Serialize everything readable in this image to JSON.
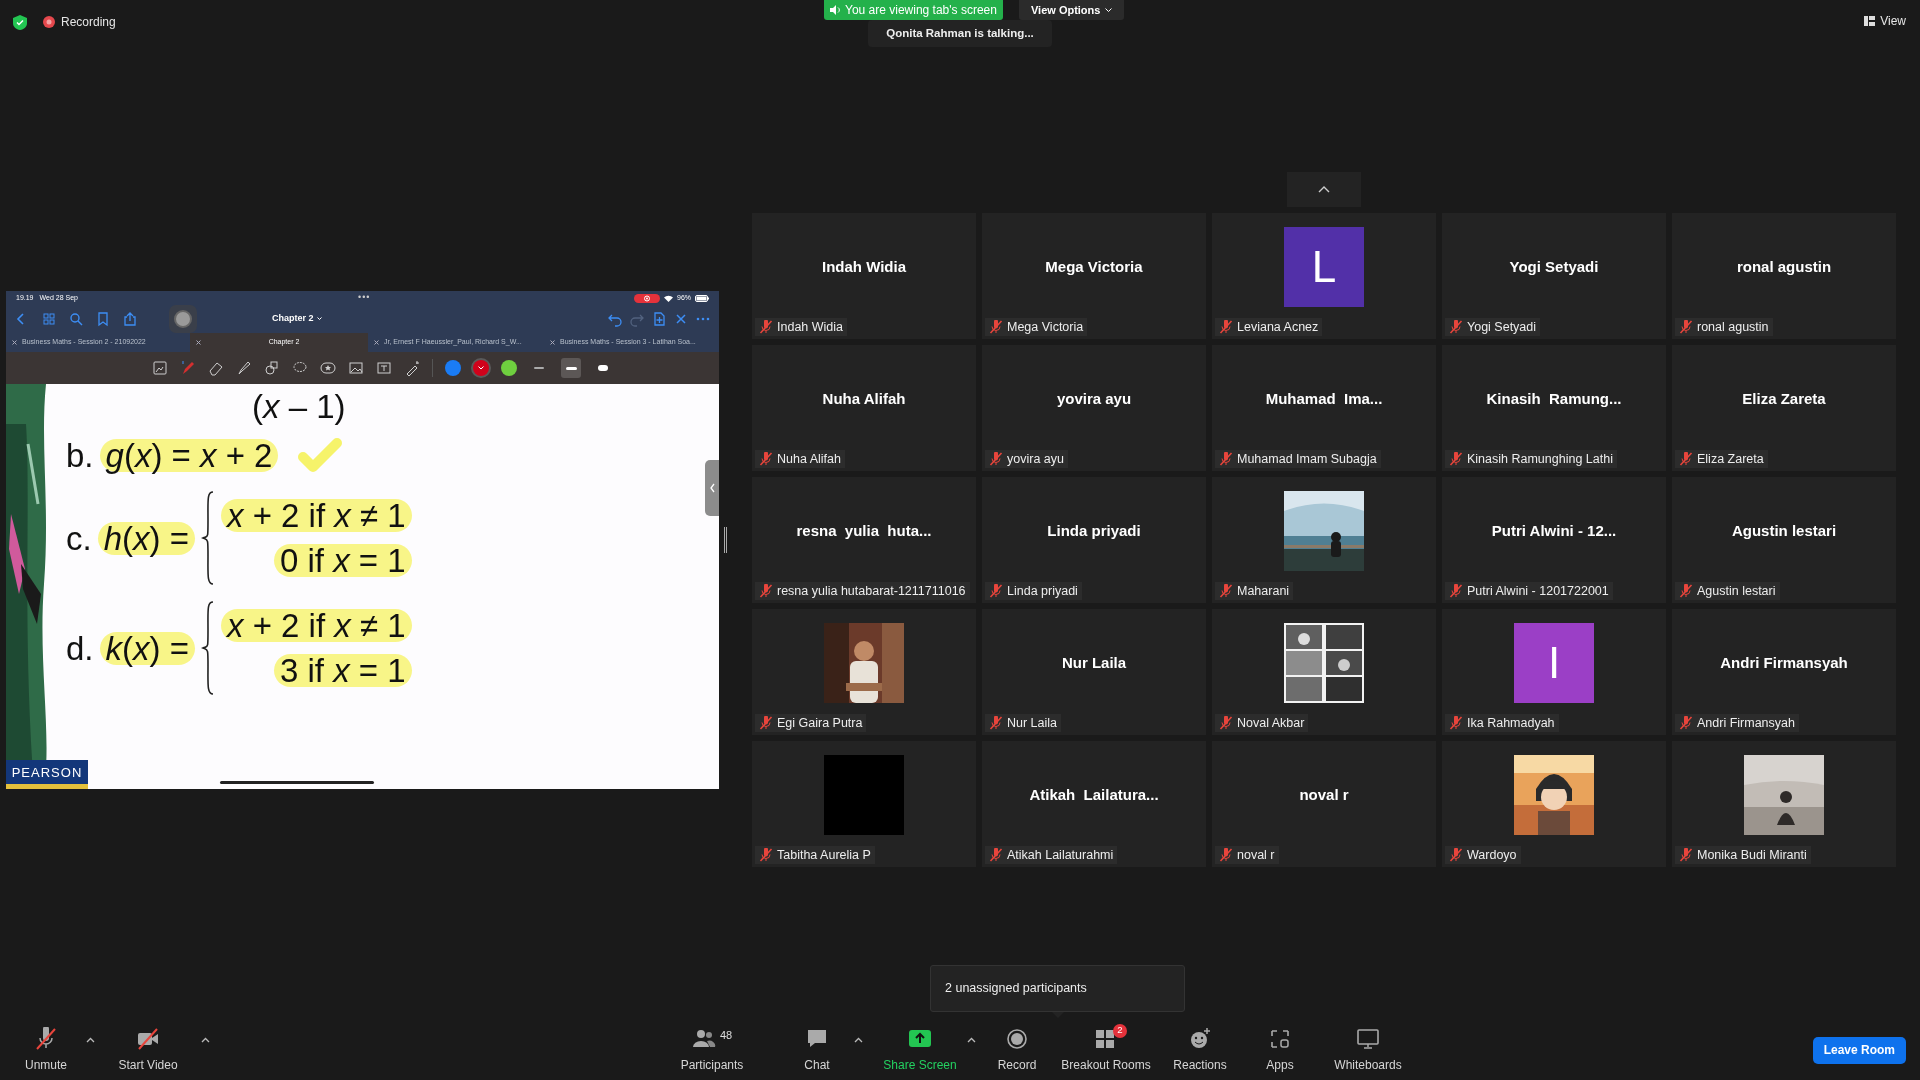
{
  "top_bar": {
    "recording": "Recording",
    "viewing_banner": "You are viewing tab's screen",
    "view_options": "View Options",
    "talking": "Qonita Rahman is talking...",
    "view": "View"
  },
  "shared_screen": {
    "time": "19.19",
    "date": "Wed 28 Sep",
    "dots": "•••",
    "battery": "96%",
    "title": "Chapter 2",
    "tabs": [
      {
        "label": "Business Maths - Session 2 - 21092022",
        "selected": false
      },
      {
        "label": "Chapter 2",
        "selected": true
      },
      {
        "label": "Jr, Ernest F Haeussler_Paul, Richard S_W...",
        "selected": false
      },
      {
        "label": "Business Maths - Session 3 - Latihan Soa...",
        "selected": false
      }
    ],
    "pen_colors": [
      {
        "color": "#1a7cf5",
        "selected": false
      },
      {
        "color": "#d0021b",
        "selected": true
      },
      {
        "color": "#6fcf3f",
        "selected": false
      }
    ],
    "line_widths": [
      {
        "selected": false
      },
      {
        "selected": true
      },
      {
        "selected": false
      }
    ],
    "slide": {
      "top_line": "(*x* – 1)",
      "items": [
        {
          "kind": "simple",
          "label": "b.",
          "expr": "*g*(*x*) = *x* + 2",
          "checked": true
        },
        {
          "kind": "cases",
          "label": "c.",
          "expr": "*h*(*x*) =",
          "cases": [
            "*x* + 2 if *x* ≠ 1",
            "0 if *x* = 1"
          ]
        },
        {
          "kind": "cases",
          "label": "d.",
          "expr": "*k*(*x*) =",
          "cases": [
            "*x* + 2 if *x* ≠ 1",
            "3 if *x* = 1"
          ]
        }
      ],
      "publisher": "PEARSON"
    }
  },
  "tiles": [
    {
      "kind": "name",
      "title": "Indah Widia",
      "label": "Indah Widia",
      "muted": true
    },
    {
      "kind": "name",
      "title": "Mega Victoria",
      "label": "Mega Victoria",
      "muted": true
    },
    {
      "kind": "letter",
      "letter": "L",
      "color": "#5230a8",
      "label": "Leviana Acnez",
      "muted": true
    },
    {
      "kind": "name",
      "title": "Yogi Setyadi",
      "label": "Yogi Setyadi",
      "muted": true
    },
    {
      "kind": "name",
      "title": "ronal agustin",
      "label": "ronal agustin",
      "muted": true
    },
    {
      "kind": "name",
      "title": "Nuha Alifah",
      "label": "Nuha Alifah",
      "muted": true
    },
    {
      "kind": "name",
      "title": "yovira ayu",
      "label": "yovira ayu",
      "muted": true
    },
    {
      "kind": "name",
      "title": "Muhamad  Ima...",
      "label": "Muhamad Imam Subagja",
      "muted": true
    },
    {
      "kind": "name",
      "title": "Kinasih  Ramung...",
      "label": "Kinasih Ramunghing Lathi",
      "muted": true
    },
    {
      "kind": "name",
      "title": "Eliza Zareta",
      "label": "Eliza Zareta",
      "muted": true
    },
    {
      "kind": "name",
      "title": "resna  yulia  huta...",
      "label": "resna yulia hutabarat-1211711016",
      "muted": true
    },
    {
      "kind": "name",
      "title": "Linda priyadi",
      "label": "Linda priyadi",
      "muted": true
    },
    {
      "kind": "picture",
      "label": "Maharani",
      "muted": true
    },
    {
      "kind": "name",
      "title": "Putri Alwini - 12...",
      "label": "Putri Alwini - 1201722001",
      "muted": true
    },
    {
      "kind": "name",
      "title": "Agustin lestari",
      "label": "Agustin lestari",
      "muted": true
    },
    {
      "kind": "picture",
      "label": "Egi Gaira Putra",
      "muted": true
    },
    {
      "kind": "name",
      "title": "Nur Laila",
      "label": "Nur Laila",
      "muted": true
    },
    {
      "kind": "picture",
      "label": "Noval Akbar",
      "muted": true
    },
    {
      "kind": "letter",
      "letter": "I",
      "color": "#9b3fc6",
      "label": "Ika Rahmadyah",
      "muted": true
    },
    {
      "kind": "name",
      "title": "Andri Firmansyah",
      "label": "Andri Firmansyah",
      "muted": true
    },
    {
      "kind": "dark",
      "label": "Tabitha Aurelia P",
      "muted": true
    },
    {
      "kind": "name",
      "title": "Atikah  Lailatura...",
      "label": "Atikah Lailaturahmi",
      "muted": true
    },
    {
      "kind": "name",
      "title": "noval r",
      "label": "noval r",
      "muted": true
    },
    {
      "kind": "picture",
      "label": "Wardoyo",
      "muted": true
    },
    {
      "kind": "picture",
      "label": "Monika Budi Miranti",
      "muted": true
    }
  ],
  "breakout_popup": "2 unassigned participants",
  "toolbar": [
    {
      "label": "Unmute",
      "caret": true,
      "off": true
    },
    {
      "label": "Start Video",
      "caret": true,
      "off": true
    },
    {
      "label": "Participants",
      "count": "48",
      "off": false
    },
    {
      "label": "Chat",
      "caret": true,
      "off": false
    },
    {
      "label": "Share Screen",
      "caret": true,
      "off": false,
      "highlighted": true
    },
    {
      "label": "Record",
      "off": false
    },
    {
      "label": "Breakout Rooms",
      "badge": "2",
      "off": false
    },
    {
      "label": "Reactions",
      "off": false
    },
    {
      "label": "Apps",
      "off": false
    },
    {
      "label": "Whiteboards",
      "off": false
    }
  ],
  "leave_button": "Leave Room"
}
